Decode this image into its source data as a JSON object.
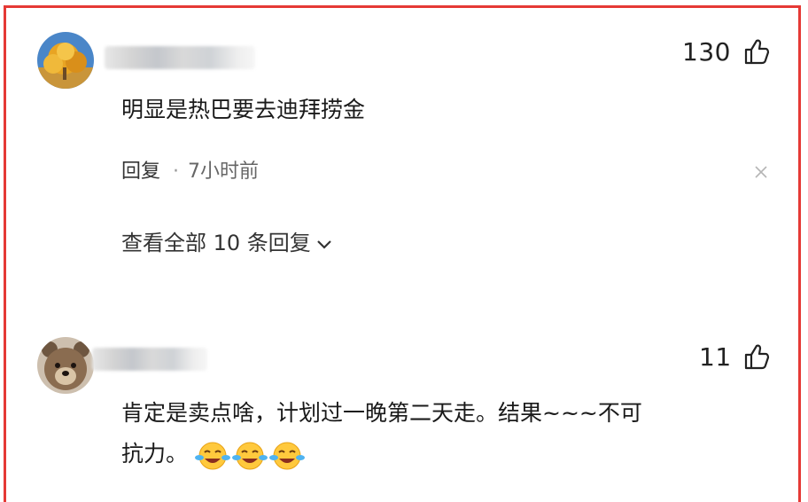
{
  "comments": [
    {
      "likes": "130",
      "text": "明显是热巴要去迪拜捞金",
      "reply_label": "回复",
      "separator": "·",
      "time": "7小时前",
      "view_replies": "查看全部 10 条回复",
      "avatar_icon": "autumn-tree-avatar"
    },
    {
      "likes": "11",
      "text_line1": "肯定是卖点啥，计划过一晚第二天走。结果~~~不可",
      "text_line2": "抗力。",
      "emojis": [
        "laughing-crying-emoji",
        "laughing-crying-emoji",
        "laughing-crying-emoji"
      ],
      "avatar_icon": "bear-avatar"
    }
  ],
  "colors": {
    "frame": "#e53935",
    "text": "#1a1a1a",
    "meta": "#666666"
  },
  "icons": {
    "like": "thumbs-up-icon",
    "close": "close-icon",
    "expand": "chevron-down-icon"
  }
}
